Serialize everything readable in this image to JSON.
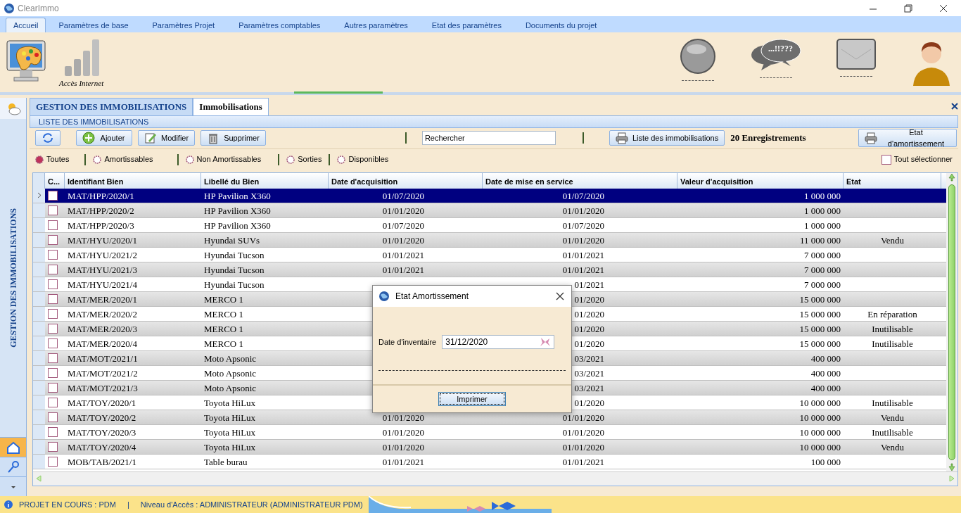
{
  "window": {
    "title": "ClearImmo"
  },
  "ribbon_tabs": [
    {
      "label": "Accueil",
      "selected": true
    },
    {
      "label": "Paramètres de base",
      "selected": false
    },
    {
      "label": "Paramètres Projet",
      "selected": false
    },
    {
      "label": "Paramètres comptables",
      "selected": false
    },
    {
      "label": "Autres paramètres",
      "selected": false
    },
    {
      "label": "Etat des paramètres",
      "selected": false
    },
    {
      "label": "Documents du projet",
      "selected": false
    }
  ],
  "ribbon": {
    "internet_label": "Accès Internet",
    "messages_badge": "...!!???"
  },
  "doc_tabs": [
    {
      "label": "GESTION DES IMMOBILISATIONS",
      "selected": false
    },
    {
      "label": "Immobilisations",
      "selected": true
    }
  ],
  "sidebar": {
    "title": "GESTION DES IMMOBILISATIONS"
  },
  "panel": {
    "title": "LISTE DES IMMOBILISATIONS"
  },
  "toolbar": {
    "buttons": [
      {
        "kind": "add",
        "label": "Ajouter"
      },
      {
        "kind": "edit",
        "label": "Modifier"
      },
      {
        "kind": "delete",
        "label": "Supprimer"
      }
    ],
    "search": {
      "placeholder": "Rechercher"
    },
    "print_list": "Liste des immobilisations",
    "count": "20 Enregistrements",
    "print_state": "Etat d'amortissement"
  },
  "filters": [
    {
      "label": "Toutes",
      "selected": true
    },
    {
      "label": "Amortissables",
      "selected": false
    },
    {
      "label": "Non Amortissables",
      "selected": false
    },
    {
      "label": "Sorties",
      "selected": false
    },
    {
      "label": "Disponibles",
      "selected": false
    }
  ],
  "select_all": {
    "label": "Tout sélectionner",
    "checked": false
  },
  "table": {
    "columns": [
      "C...",
      "Identifiant Bien",
      "Libellé du Bien",
      "Date d'acquisition",
      "Date de mise en service",
      "Valeur d'acquisition",
      "Etat"
    ],
    "rows": [
      {
        "id": "MAT/HPP/2020/1",
        "label": "HP Pavilion X360",
        "acquired": "01/07/2020",
        "service": "01/07/2020",
        "value": "1 000 000",
        "checked": false,
        "selected": true
      },
      {
        "id": "MAT/HPP/2020/2",
        "label": "HP Pavilion X360",
        "acquired": "01/01/2020",
        "service": "01/01/2020",
        "value": "1 000 000",
        "checked": false,
        "selected": false
      },
      {
        "id": "MAT/HPP/2020/3",
        "label": "HP Pavilion X360",
        "acquired": "01/07/2020",
        "service": "01/07/2020",
        "value": "1 000 000",
        "checked": false,
        "selected": false
      },
      {
        "id": "MAT/HYU/2020/1",
        "label": "Hyundai SUVs",
        "acquired": "01/01/2020",
        "service": "01/01/2020",
        "value": "11 000 000",
        "state": "Vendu",
        "checked": false,
        "selected": false
      },
      {
        "id": "MAT/HYU/2021/2",
        "label": "Hyundai Tucson",
        "acquired": "01/01/2021",
        "service": "01/01/2021",
        "value": "7 000 000",
        "checked": false,
        "selected": false
      },
      {
        "id": "MAT/HYU/2021/3",
        "label": "Hyundai Tucson",
        "acquired": "01/01/2021",
        "service": "01/01/2021",
        "value": "7 000 000",
        "checked": false,
        "selected": false
      },
      {
        "id": "MAT/HYU/2021/4",
        "label": "Hyundai Tucson",
        "service": "01/2021",
        "value": "7 000 000",
        "checked": false,
        "selected": false
      },
      {
        "id": "MAT/MER/2020/1",
        "label": "MERCO 1",
        "service": "01/2020",
        "value": "15 000 000",
        "checked": false,
        "selected": false
      },
      {
        "id": "MAT/MER/2020/2",
        "label": "MERCO 1",
        "service": "01/2020",
        "value": "15 000 000",
        "state": "En réparation",
        "checked": false,
        "selected": false
      },
      {
        "id": "MAT/MER/2020/3",
        "label": "MERCO 1",
        "service": "01/2020",
        "value": "15 000 000",
        "state": "Inutilisable",
        "checked": false,
        "selected": false
      },
      {
        "id": "MAT/MER/2020/4",
        "label": "MERCO 1",
        "service": "01/2020",
        "value": "15 000 000",
        "state": "Inutilisable",
        "checked": false,
        "selected": false
      },
      {
        "id": "MAT/MOT/2021/1",
        "label": "Moto Apsonic",
        "service": "03/2021",
        "value": "400 000",
        "checked": false,
        "selected": false
      },
      {
        "id": "MAT/MOT/2021/2",
        "label": "Moto Apsonic",
        "service": "03/2021",
        "value": "400 000",
        "checked": false,
        "selected": false
      },
      {
        "id": "MAT/MOT/2021/3",
        "label": "Moto Apsonic",
        "service": "03/2021",
        "value": "400 000",
        "checked": false,
        "selected": false
      },
      {
        "id": "MAT/TOY/2020/1",
        "label": "Toyota HiLux",
        "service": "01/2020",
        "value": "10 000 000",
        "state": "Inutilisable",
        "checked": false,
        "selected": false
      },
      {
        "id": "MAT/TOY/2020/2",
        "label": "Toyota HiLux",
        "acquired": "01/01/2020",
        "service": "01/01/2020",
        "value": "10 000 000",
        "state": "Vendu",
        "checked": false,
        "selected": false
      },
      {
        "id": "MAT/TOY/2020/3",
        "label": "Toyota HiLux",
        "acquired": "01/01/2020",
        "service": "01/01/2020",
        "value": "10 000 000",
        "state": "Inutilisable",
        "checked": false,
        "selected": false
      },
      {
        "id": "MAT/TOY/2020/4",
        "label": "Toyota HiLux",
        "acquired": "01/01/2020",
        "service": "01/01/2020",
        "value": "10 000 000",
        "state": "Vendu",
        "checked": false,
        "selected": false
      },
      {
        "id": "MOB/TAB/2021/1",
        "label": "Table burau",
        "acquired": "01/01/2021",
        "service": "01/01/2021",
        "value": "100 000",
        "checked": false,
        "selected": false
      }
    ]
  },
  "dialog": {
    "title": "Etat Amortissement",
    "field_label": "Date d'inventaire",
    "field_value": "31/12/2020",
    "button": "Imprimer"
  },
  "status_bar": {
    "project": "PROJET EN COURS : PDM",
    "separator": "|",
    "access": "Niveau d'Accès : ADMINISTRATEUR (ADMINISTRATEUR PDM)"
  }
}
